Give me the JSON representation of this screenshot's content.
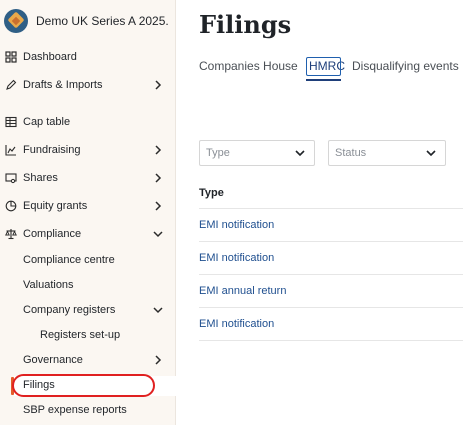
{
  "company": {
    "name": "Demo UK Series A 2025."
  },
  "sidebar": {
    "items": [
      {
        "label": "Dashboard",
        "icon": "grid-icon"
      },
      {
        "label": "Drafts & Imports",
        "icon": "pencil-icon"
      },
      {
        "label": "Cap table",
        "icon": "table-icon"
      },
      {
        "label": "Fundraising",
        "icon": "chart-icon"
      },
      {
        "label": "Shares",
        "icon": "certificate-icon"
      },
      {
        "label": "Equity grants",
        "icon": "pie-icon"
      },
      {
        "label": "Compliance",
        "icon": "scales-icon"
      }
    ],
    "sub_items": [
      {
        "label": "Compliance centre"
      },
      {
        "label": "Valuations"
      },
      {
        "label": "Company registers"
      },
      {
        "label": "Registers set-up"
      },
      {
        "label": "Governance"
      },
      {
        "label": "Filings"
      },
      {
        "label": "SBP expense reports"
      }
    ]
  },
  "main": {
    "title": "Filings",
    "tabs": [
      {
        "label": "Companies House"
      },
      {
        "label": "HMRC"
      },
      {
        "label": "Disqualifying events"
      }
    ],
    "filters": {
      "type_placeholder": "Type",
      "status_placeholder": "Status"
    },
    "table": {
      "column": "Type",
      "rows": [
        {
          "label": "EMI notification"
        },
        {
          "label": "EMI notification"
        },
        {
          "label": "EMI annual return"
        },
        {
          "label": "EMI notification"
        }
      ]
    }
  },
  "colors": {
    "accent": "#e45b2a",
    "link": "#1f4f8f",
    "annotation": "#e02020"
  }
}
